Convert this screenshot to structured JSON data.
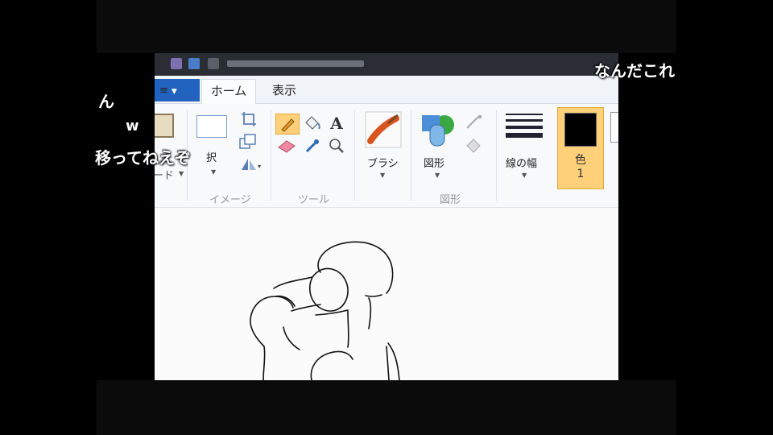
{
  "ribbon": {
    "file_tab_label": "≡",
    "tabs": [
      {
        "label": "ホーム",
        "active": true
      },
      {
        "label": "表示",
        "active": false
      }
    ],
    "groups": {
      "clipboard": {
        "label": "ード"
      },
      "image": {
        "label": "イメージ",
        "select_label": "択"
      },
      "tools": {
        "label": "ツール"
      },
      "brush": {
        "label": "ブラシ"
      },
      "shapes": {
        "label": "図形",
        "shapes_button_label": "図形"
      },
      "line_width": {
        "label": "線の幅"
      },
      "color1": {
        "label": "色",
        "number": "1",
        "color": "#000000"
      }
    }
  },
  "comments": [
    {
      "text": "なんだこれ"
    },
    {
      "text": "ん"
    },
    {
      "text": "w"
    },
    {
      "text": "移ってねえぞ"
    }
  ]
}
